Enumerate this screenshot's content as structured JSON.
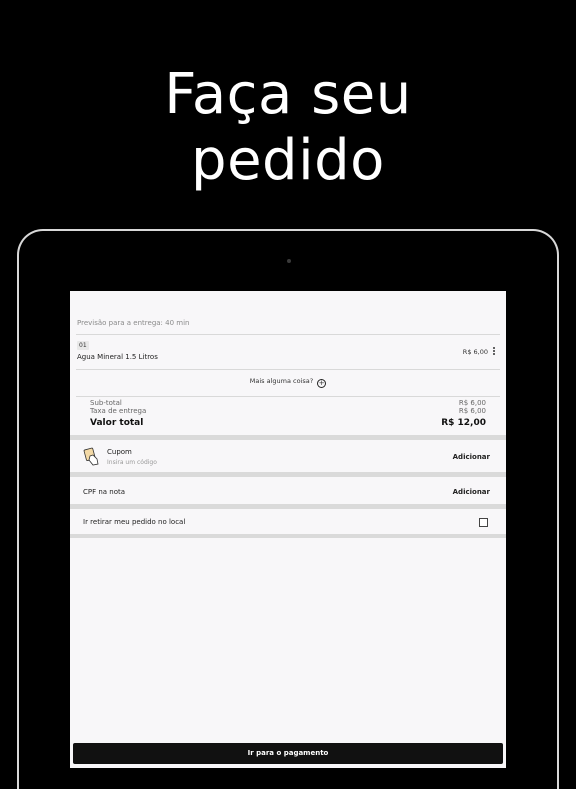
{
  "headline": {
    "line1": "Faça seu",
    "line2": "pedido"
  },
  "order": {
    "estimate": "Previsão para a entrega: 40 min",
    "item": {
      "qty": "01",
      "name": "Agua Mineral 1.5 Litros",
      "price": "R$ 6,00"
    },
    "more_label": "Mais alguma coisa?",
    "subtotal_label": "Sub-total",
    "subtotal_value": "R$ 6,00",
    "delivery_label": "Taxa de entrega",
    "delivery_value": "R$ 6,00",
    "total_label": "Valor total",
    "total_value": "R$ 12,00"
  },
  "coupon": {
    "title": "Cupom",
    "subtitle": "Insira um código",
    "action": "Adicionar"
  },
  "cpf": {
    "label": "CPF na nota",
    "action": "Adicionar"
  },
  "pickup": {
    "label": "Ir retirar meu pedido no local",
    "checked": false
  },
  "pay_button": "Ir para o pagamento",
  "icons": {
    "coupon": "coupon-hand-icon",
    "more": "plus-circle-icon",
    "item_menu": "kebab-menu-icon"
  }
}
